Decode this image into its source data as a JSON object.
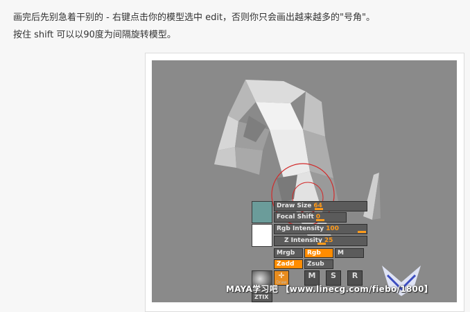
{
  "article": {
    "line1": "画完后先别急着干别的 - 右键点击你的模型选中 edit，否则你只会画出越来越多的\"号角\"。",
    "line2": "按住 shift 可以以90度为间隔旋转模型。"
  },
  "zbrush_panel": {
    "draw_size": {
      "label": "Draw Size",
      "value": "64"
    },
    "focal_shift": {
      "label": "Focal Shift",
      "value": "0"
    },
    "rgb_intensity": {
      "label": "Rgb Intensity",
      "value": "100"
    },
    "z_intensity": {
      "label": "Z Intensity",
      "value": "25"
    },
    "buttons": {
      "mrgb": "Mrgb",
      "rgb": "Rgb",
      "m": "M",
      "zadd": "Zadd",
      "zsub": "Zsub"
    },
    "tools": {
      "draw_caption": "Draw",
      "move": "M",
      "scale": "S",
      "rotate": "R"
    },
    "bottom_label": "ZTIX"
  },
  "watermark": "MAYA学习吧 【www.linecg.com/fiebo/1800】",
  "colors": {
    "accent": "#ff8c00",
    "viewport_bg": "#8a8a8a",
    "brush_ring": "#d22a2a"
  }
}
